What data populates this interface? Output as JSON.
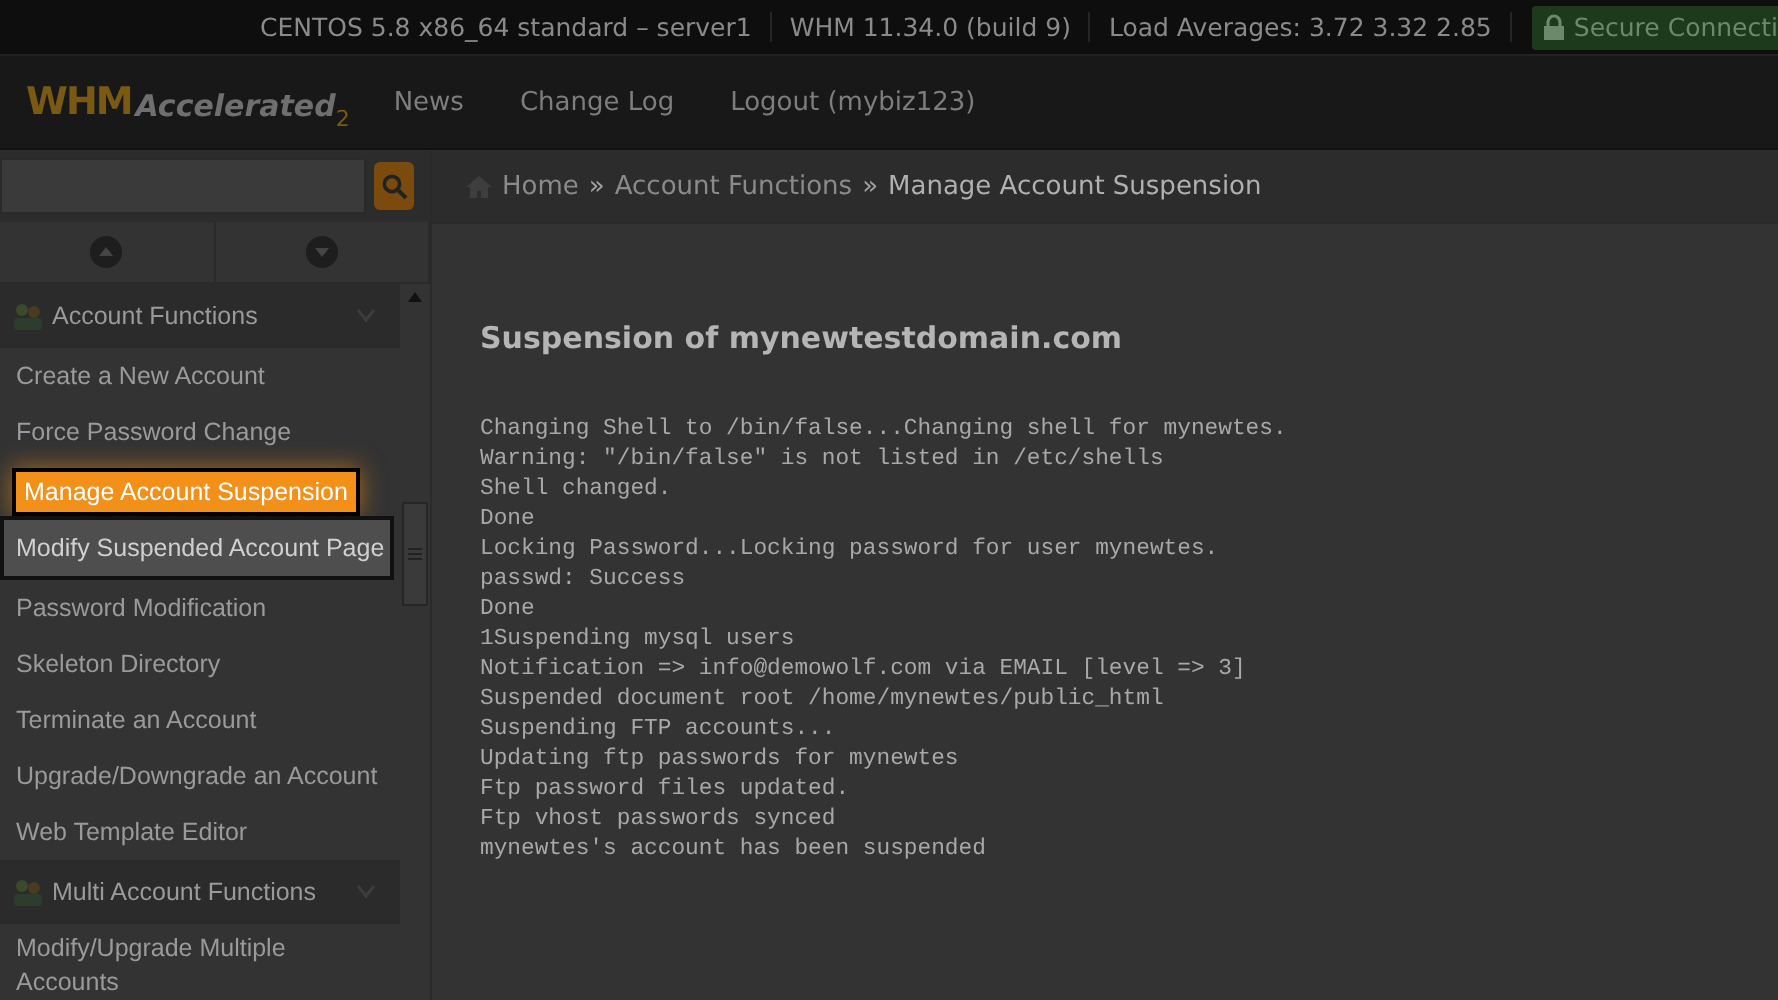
{
  "top_bar": {
    "items": [
      "CENTOS 5.8 x86_64 standard – server1",
      "WHM 11.34.0 (build 9)",
      "Load Averages: 3.72 3.32 2.85"
    ],
    "secure": "Secure Connecti"
  },
  "header": {
    "logo": "WHM",
    "logo_sub": "Accelerated",
    "logo_ver": "2",
    "nav": [
      "News",
      "Change Log",
      "Logout (mybiz123)"
    ]
  },
  "breadcrumb": [
    "Home",
    "Account Functions",
    "Manage Account Suspension"
  ],
  "breadcrumb_sep": "»",
  "sidebar": {
    "groups": [
      {
        "title": "Account Functions",
        "items": [
          {
            "label": "Create a New Account",
            "selected": false,
            "hovered": false
          },
          {
            "label": "Force Password Change",
            "selected": false,
            "hovered": false
          },
          {
            "label": "Manage Account Suspension",
            "selected": true,
            "hovered": false
          },
          {
            "label": "Modify Suspended Account Page",
            "selected": false,
            "hovered": true
          },
          {
            "label": "Password Modification",
            "selected": false,
            "hovered": false
          },
          {
            "label": "Skeleton Directory",
            "selected": false,
            "hovered": false
          },
          {
            "label": "Terminate an Account",
            "selected": false,
            "hovered": false
          },
          {
            "label": "Upgrade/Downgrade an Account",
            "selected": false,
            "hovered": false
          },
          {
            "label": "Web Template Editor",
            "selected": false,
            "hovered": false
          }
        ]
      },
      {
        "title": "Multi Account Functions",
        "items": [
          {
            "label": "Modify/Upgrade Multiple Accounts",
            "selected": false,
            "hovered": false
          }
        ]
      }
    ]
  },
  "content": {
    "title": "Suspension of mynewtestdomain.com",
    "log": [
      "Changing Shell to /bin/false...Changing shell for mynewtes.",
      "Warning: \"/bin/false\" is not listed in /etc/shells",
      "Shell changed.",
      "Done",
      "Locking Password...Locking password for user mynewtes.",
      "passwd: Success",
      "Done",
      "1Suspending mysql users",
      "Notification => info@demowolf.com via EMAIL [level => 3]",
      "Suspended document root /home/mynewtes/public_html",
      "Suspending FTP accounts...",
      "Updating ftp passwords for mynewtes",
      "Ftp password files updated.",
      "Ftp vhost passwords synced",
      "mynewtes's account has been suspended"
    ]
  }
}
